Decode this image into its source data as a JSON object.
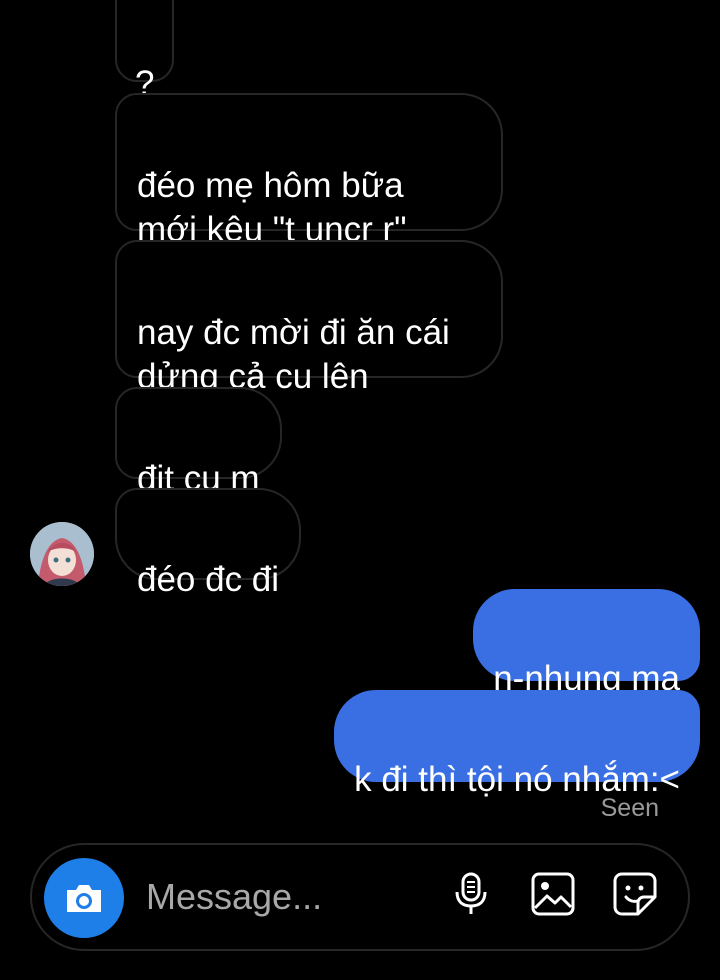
{
  "messages": {
    "incoming": [
      {
        "text": "?"
      },
      {
        "text": "đéo mẹ hôm bữa\nmới kêu \"t uncr r\""
      },
      {
        "text": "nay đc mời đi ăn cái\ndửng cả cu lên"
      },
      {
        "text": "địt cụ m"
      },
      {
        "text": "đéo đc đi"
      }
    ],
    "outgoing": [
      {
        "text": "n-nhung ma"
      },
      {
        "text": "k đi thì tội nó nhắm:<"
      }
    ],
    "status": "Seen"
  },
  "composer": {
    "placeholder": "Message..."
  },
  "icons": {
    "camera": "camera-icon",
    "mic": "microphone-icon",
    "gallery": "image-icon",
    "sticker": "sticker-icon"
  },
  "colors": {
    "background": "#000000",
    "incoming_border": "#262626",
    "outgoing_bubble": "#3a6fe4",
    "camera_button": "#1f7fe8",
    "seen_text": "#9a9a9a"
  }
}
